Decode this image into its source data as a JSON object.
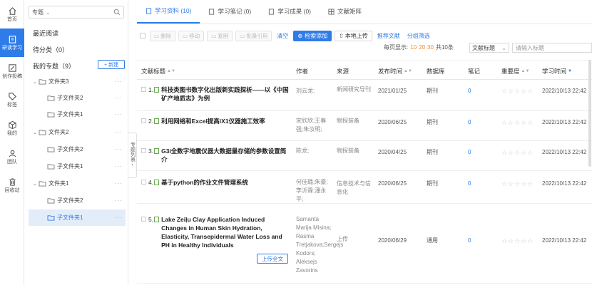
{
  "rail": [
    {
      "name": "home",
      "label": "首页",
      "icon": "home-icon"
    },
    {
      "name": "study",
      "label": "研读学习",
      "icon": "book-icon",
      "active": true
    },
    {
      "name": "create",
      "label": "创作投稿",
      "icon": "edit-icon"
    },
    {
      "name": "tags",
      "label": "标签",
      "icon": "tag-icon"
    },
    {
      "name": "mine",
      "label": "我的",
      "icon": "cube-icon"
    },
    {
      "name": "team",
      "label": "团队",
      "icon": "team-icon"
    },
    {
      "name": "recycle",
      "label": "回收站",
      "icon": "trash-icon"
    }
  ],
  "panel": {
    "select_value": "专题",
    "recent": "最近阅读",
    "pending": "待分类（0）",
    "my_topics": "我的专题（9）",
    "new_label": "+ 新建",
    "tree": [
      {
        "label": "文件夹3",
        "level": 0
      },
      {
        "label": "子文件夹2",
        "level": 1
      },
      {
        "label": "子文件夹1",
        "level": 1
      },
      {
        "label": "文件夹2",
        "level": 0
      },
      {
        "label": "子文件夹2",
        "level": 1
      },
      {
        "label": "子文件夹1",
        "level": 1
      },
      {
        "label": "文件夹1",
        "level": 0
      },
      {
        "label": "子文件夹2",
        "level": 1
      },
      {
        "label": "子文件夹1",
        "level": 1,
        "selected": true
      }
    ],
    "collapse_label": "专题列表"
  },
  "tabs": [
    {
      "label": "学习资料 (10)",
      "active": true
    },
    {
      "label": "学习笔记 (0)"
    },
    {
      "label": "学习成果 (0)"
    },
    {
      "label": "文献矩阵"
    }
  ],
  "toolbar": {
    "delete": "删除",
    "move": "移动",
    "copy": "复制",
    "batch_cite": "批量引用",
    "clear": "清空",
    "search_add": "检索添加",
    "local_upload": "本地上传",
    "recommend": "推荐文献",
    "group_filter": "分组筛选"
  },
  "pager": {
    "prefix": "每页显示:",
    "opt1": "10",
    "opt2": "20",
    "opt3": "30",
    "total": "共10条"
  },
  "sort_select": "文献标题",
  "search_placeholder": "请输入标题",
  "columns": {
    "title": "文献标题",
    "author": "作者",
    "source": "来源",
    "pubdate": "发布时间",
    "database": "数据库",
    "notes": "笔记",
    "importance": "重要度",
    "studytime": "学习时间"
  },
  "rows": [
    {
      "idx": "1.",
      "title": "科技类图书数字化出版新实践探析——以《中国矿产地质志》为例",
      "author": "刘云龙;",
      "source": "新闻研究导刊",
      "date": "2021/01/25",
      "db": "期刊",
      "notes": "0",
      "time": "2022/10/13 22:42"
    },
    {
      "idx": "2.",
      "title": "利用网络和Excel提高iX1仪器施工效率",
      "author": "宋欣欣;王春强;朱汝明;",
      "source": "物探装备",
      "date": "2020/06/25",
      "db": "期刊",
      "notes": "0",
      "time": "2022/10/13 22:42"
    },
    {
      "idx": "3.",
      "title": "G3i全数字地震仪器大数据量存储的参数设置简介",
      "author": "陈龙;",
      "source": "物探装备",
      "date": "2020/04/25",
      "db": "期刊",
      "notes": "0",
      "time": "2022/10/13 22:42"
    },
    {
      "idx": "4.",
      "title": "基于python的作业文件管理系统",
      "author": "何佳璐;朱豪;李沂霖;潘永平;",
      "source": "信息技术与信息化",
      "date": "2020/06/25",
      "db": "期刊",
      "notes": "0",
      "time": "2022/10/13 22:42"
    },
    {
      "idx": "5.",
      "title": "Lake Zeiļu Clay Application Induced Changes in Human Skin Hydration, Elasticity, Transepidermal Water Loss and PH in Healthy Individuals",
      "author": "Samanta Marija Misina; Rasma Tretjakova;Sergejs Kodors; Aleksejs Zavorins",
      "source": "上传",
      "date": "2020/06/29",
      "db": "通用",
      "notes": "0",
      "time": "2022/10/13 22:42",
      "upload_label": "上传全文"
    }
  ],
  "stars": "☆☆☆☆☆"
}
